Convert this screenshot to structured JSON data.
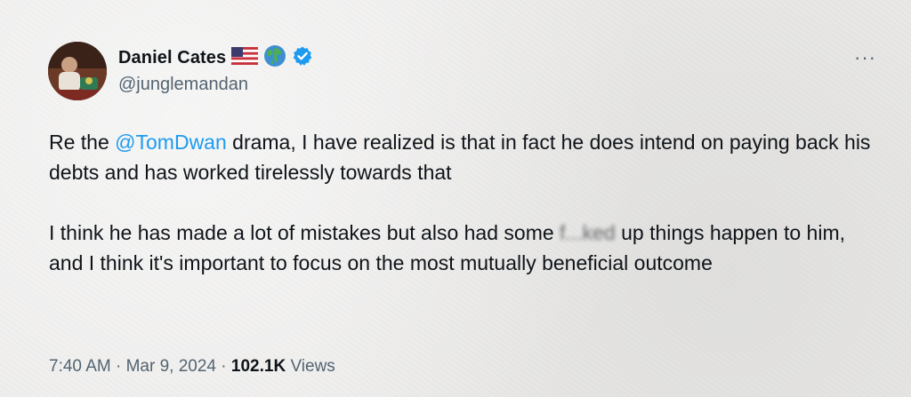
{
  "author": {
    "display_name": "Daniel Cates",
    "handle": "@junglemandan",
    "badges": [
      "us-flag-icon",
      "globe-icon",
      "verified-badge-icon"
    ]
  },
  "more_menu": {
    "label": "···"
  },
  "tweet": {
    "para1_prefix": "Re the ",
    "mention": "@TomDwan",
    "para1_suffix": " drama, I have realized is that in fact he does intend on paying back his debts and has worked tirelessly towards that",
    "para2_prefix": "I think he has made a lot of mistakes but also had some ",
    "para2_censored": "f...ked",
    "para2_suffix": " up things happen to him, and I think it's important to focus on the most mutually beneficial outcome"
  },
  "meta": {
    "time": "7:40 AM",
    "sep1": " · ",
    "date": "Mar 9, 2024",
    "sep2": " · ",
    "views_count": "102.1K",
    "views_label": " Views"
  },
  "colors": {
    "mention": "#1d9bf0",
    "secondary_text": "#536471",
    "verified": "#1d9bf0"
  }
}
